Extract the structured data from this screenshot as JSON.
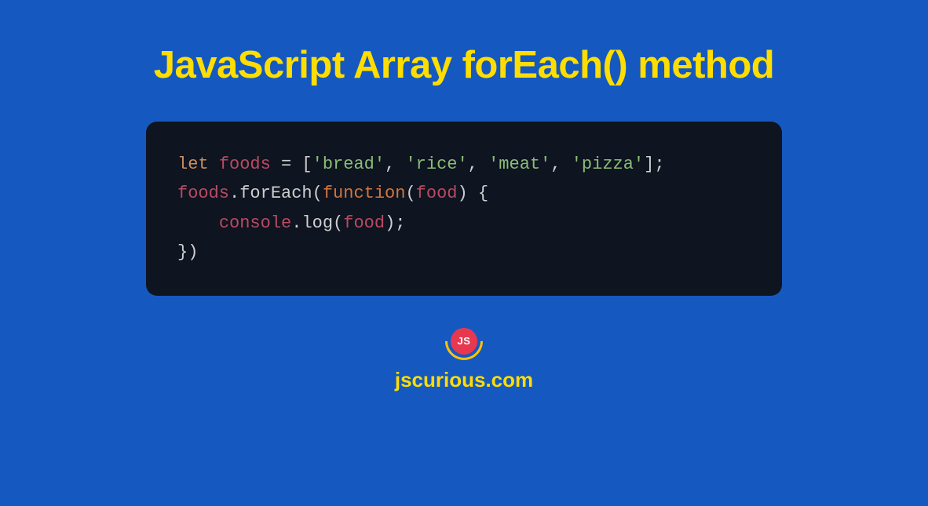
{
  "title": "JavaScript Array forEach() method",
  "code": {
    "line1": {
      "let": "let",
      "var": "foods",
      "equals": " = [",
      "str1": "'bread'",
      "comma1": ", ",
      "str2": "'rice'",
      "comma2": ", ",
      "str3": "'meat'",
      "comma3": ", ",
      "str4": "'pizza'",
      "close": "];"
    },
    "blank": "",
    "line2": {
      "obj": "foods",
      "dot1": ".",
      "method": "forEach",
      "open": "(",
      "func": "function",
      "popen": "(",
      "param": "food",
      "pclose": ") {"
    },
    "line3": {
      "indent": "    ",
      "console": "console",
      "dot": ".",
      "log": "log",
      "open": "(",
      "arg": "food",
      "close": ");"
    },
    "line4": {
      "text": "})"
    }
  },
  "logo": {
    "text": "JS"
  },
  "site": "jscurious.com"
}
